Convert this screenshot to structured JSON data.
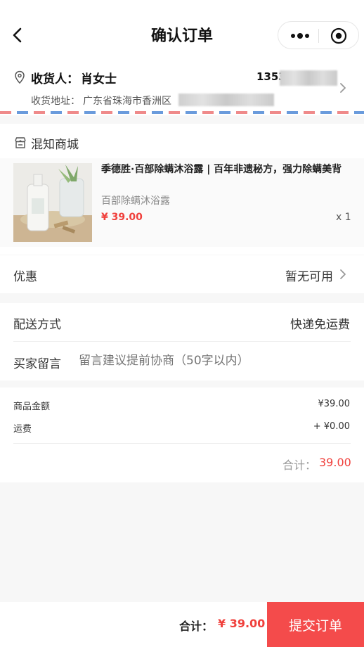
{
  "nav": {
    "title": "确认订单"
  },
  "address": {
    "recipient_label": "收货人：",
    "recipient_name": "肖女士",
    "phone_visible": "1353",
    "address_label": "收货地址：",
    "address_visible": "广东省珠海市香洲区"
  },
  "shop": {
    "name": "混知商城",
    "product": {
      "title": "季德胜·百部除螨沐浴露 | 百年非遗秘方，强力除螨美背",
      "spec": "百部除螨沐浴露",
      "price": "¥ 39.00",
      "quantity": "x 1"
    }
  },
  "discount": {
    "label": "优惠",
    "value": "暂无可用"
  },
  "delivery": {
    "label": "配送方式",
    "value": "快递免运费"
  },
  "message": {
    "label": "买家留言",
    "placeholder": "留言建议提前协商（50字以内）"
  },
  "summary": {
    "goods_label": "商品金额",
    "goods_value": "¥39.00",
    "shipping_label": "运费",
    "shipping_value": "+ ¥0.00",
    "total_label": "合计：",
    "total_value": "39.00"
  },
  "bottom": {
    "total_label": "合计：",
    "total_value": "¥ 39.00",
    "submit_label": "提交订单"
  },
  "colors": {
    "accent": "#f0403c",
    "submit_bg": "#f44b4b"
  }
}
